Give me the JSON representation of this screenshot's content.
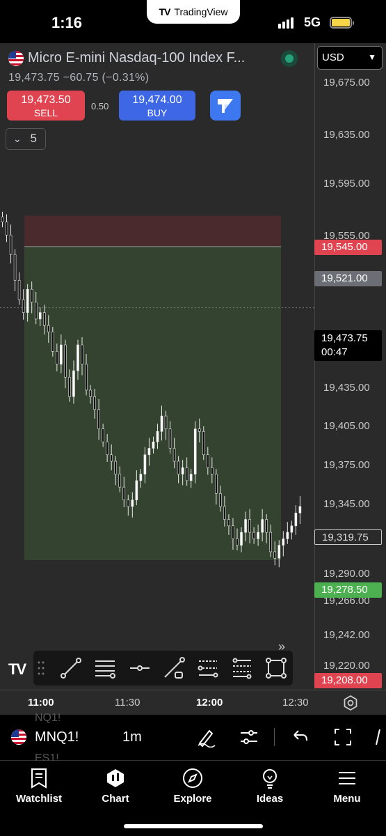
{
  "status_bar": {
    "time": "1:16",
    "app_badge": "TradingView",
    "network": "5G"
  },
  "instrument": {
    "name": "Micro E-mini Nasdaq-100 Index F...",
    "quote": "19,473.75 −60.75 (−0.31%)",
    "status": "market-open"
  },
  "trade_panel": {
    "sell_price": "19,473.50",
    "sell_label": "SELL",
    "spread": "0.50",
    "buy_price": "19,474.00",
    "buy_label": "BUY",
    "collapse_value": "5"
  },
  "price_scale": {
    "currency": "USD",
    "ticks": [
      "19,675.00",
      "19,635.00",
      "19,595.00",
      "19,555.00",
      "19,435.00",
      "19,405.00",
      "19,375.00",
      "19,345.00",
      "19,290.00",
      "19,266.00",
      "19,242.00",
      "19,220.00"
    ],
    "labels": {
      "stop": "19,545.00",
      "entry": "19,521.00",
      "last": "19,473.75",
      "countdown": "00:47",
      "outline": "19,319.75",
      "target": "19,278.50",
      "low": "19,208.00"
    }
  },
  "colors": {
    "stop_zone": "#4a2a2c",
    "target_zone": "#34432f",
    "sell": "#e04450",
    "buy": "#3e67e6",
    "stop_tag": "#e04450",
    "entry_tag": "#6b6e75",
    "target_tag": "#4caf50"
  },
  "time_axis": {
    "labels": [
      "11:00",
      "11:30",
      "12:00",
      "12:30"
    ]
  },
  "bottom_toolbar": {
    "symbol": "MNQ1!",
    "interval": "1m",
    "ghost_above": "NQ1!",
    "ghost_below": "ES1!"
  },
  "drawing_tools": [
    "trend-line-icon",
    "horizontal-lines-icon",
    "horizontal-ray-icon",
    "path-icon",
    "parallel-channel-icon",
    "fib-retracement-icon",
    "rectangle-icon"
  ],
  "tabs": [
    {
      "label": "Watchlist",
      "icon": "watchlist-icon"
    },
    {
      "label": "Chart",
      "icon": "chart-icon"
    },
    {
      "label": "Explore",
      "icon": "compass-icon"
    },
    {
      "label": "Ideas",
      "icon": "lightbulb-icon"
    },
    {
      "label": "Menu",
      "icon": "hamburger-icon"
    }
  ],
  "chart_data": {
    "type": "candlestick",
    "symbol": "MNQ1!",
    "interval": "1m",
    "y_axis": {
      "min": 19200,
      "max": 19690
    },
    "x_axis_labels": [
      "11:00",
      "11:30",
      "12:00",
      "12:30"
    ],
    "last_price": 19473.75,
    "position": {
      "side": "short",
      "entry": 19521.0,
      "stop": 19545.0,
      "target": 19278.5
    },
    "close_path": [
      19540,
      19530,
      19515,
      19495,
      19480,
      19470,
      19488,
      19478,
      19465,
      19470,
      19460,
      19455,
      19440,
      19430,
      19445,
      19420,
      19405,
      19425,
      19445,
      19430,
      19410,
      19405,
      19395,
      19380,
      19370,
      19360,
      19355,
      19345,
      19335,
      19325,
      19320,
      19325,
      19340,
      19345,
      19360,
      19365,
      19370,
      19378,
      19390,
      19380,
      19365,
      19355,
      19345,
      19350,
      19340,
      19345,
      19380,
      19378,
      19360,
      19350,
      19345,
      19330,
      19320,
      19310,
      19305,
      19295,
      19290,
      19300,
      19310,
      19300,
      19295,
      19300,
      19310,
      19300,
      19285,
      19280,
      19290,
      19295,
      19300,
      19305,
      19315,
      19320
    ]
  }
}
